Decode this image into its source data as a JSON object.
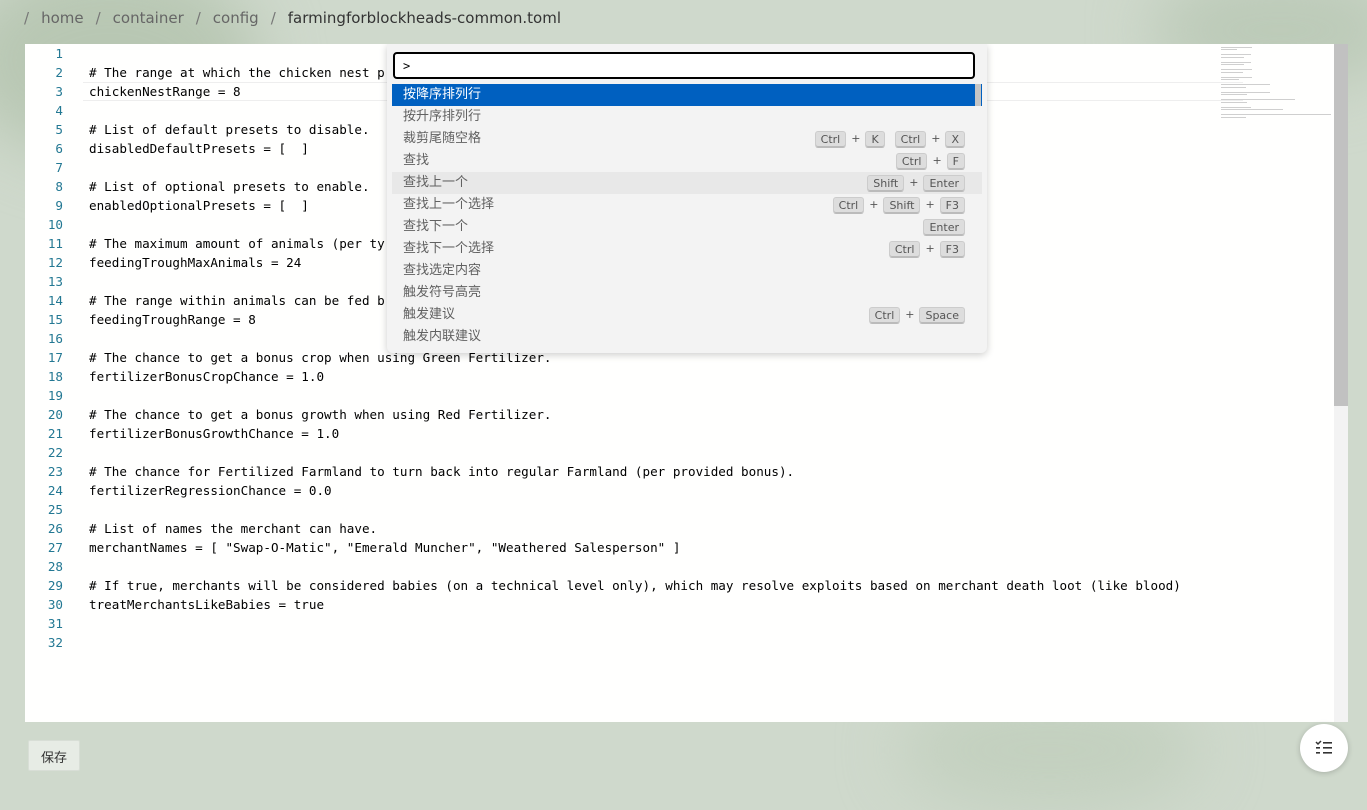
{
  "breadcrumb": [
    {
      "label": "home"
    },
    {
      "label": "container"
    },
    {
      "label": "config"
    },
    {
      "label": "farmingforblockheads-common.toml"
    }
  ],
  "breadcrumb_separator": "/",
  "editor": {
    "lines": [
      {
        "n": "1",
        "text": ""
      },
      {
        "n": "2",
        "text": "# The range at which the chicken nest p"
      },
      {
        "n": "3",
        "text": "chickenNestRange = 8"
      },
      {
        "n": "4",
        "text": ""
      },
      {
        "n": "5",
        "text": "# List of default presets to disable."
      },
      {
        "n": "6",
        "text": "disabledDefaultPresets = [  ]"
      },
      {
        "n": "7",
        "text": ""
      },
      {
        "n": "8",
        "text": "# List of optional presets to enable."
      },
      {
        "n": "9",
        "text": "enabledOptionalPresets = [  ]"
      },
      {
        "n": "10",
        "text": ""
      },
      {
        "n": "11",
        "text": "# The maximum amount of animals (per ty"
      },
      {
        "n": "12",
        "text": "feedingTroughMaxAnimals = 24"
      },
      {
        "n": "13",
        "text": ""
      },
      {
        "n": "14",
        "text": "# The range within animals can be fed b"
      },
      {
        "n": "15",
        "text": "feedingTroughRange = 8"
      },
      {
        "n": "16",
        "text": ""
      },
      {
        "n": "17",
        "text": "# The chance to get a bonus crop when using Green Fertilizer."
      },
      {
        "n": "18",
        "text": "fertilizerBonusCropChance = 1.0"
      },
      {
        "n": "19",
        "text": ""
      },
      {
        "n": "20",
        "text": "# The chance to get a bonus growth when using Red Fertilizer."
      },
      {
        "n": "21",
        "text": "fertilizerBonusGrowthChance = 1.0"
      },
      {
        "n": "22",
        "text": ""
      },
      {
        "n": "23",
        "text": "# The chance for Fertilized Farmland to turn back into regular Farmland (per provided bonus)."
      },
      {
        "n": "24",
        "text": "fertilizerRegressionChance = 0.0"
      },
      {
        "n": "25",
        "text": ""
      },
      {
        "n": "26",
        "text": "# List of names the merchant can have."
      },
      {
        "n": "27",
        "text": "merchantNames = [ \"Swap-O-Matic\", \"Emerald Muncher\", \"Weathered Salesperson\" ]"
      },
      {
        "n": "28",
        "text": ""
      },
      {
        "n": "29",
        "text": "# If true, merchants will be considered babies (on a technical level only), which may resolve exploits based on merchant death loot (like blood)"
      },
      {
        "n": "30",
        "text": "treatMerchantsLikeBabies = true"
      },
      {
        "n": "31",
        "text": ""
      },
      {
        "n": "32",
        "text": ""
      }
    ]
  },
  "command_palette": {
    "input_value": ">",
    "items": [
      {
        "label": "按降序排列行",
        "state": "selected",
        "keys": []
      },
      {
        "label": "按升序排列行",
        "state": "",
        "keys": []
      },
      {
        "label": "裁剪尾随空格",
        "state": "",
        "keys": [
          [
            "Ctrl",
            "K"
          ],
          [
            "Ctrl",
            "X"
          ]
        ]
      },
      {
        "label": "查找",
        "state": "",
        "keys": [
          [
            "Ctrl",
            "F"
          ]
        ]
      },
      {
        "label": "查找上一个",
        "state": "hover",
        "keys": [
          [
            "Shift",
            "Enter"
          ]
        ]
      },
      {
        "label": "查找上一个选择",
        "state": "",
        "keys": [
          [
            "Ctrl",
            "Shift",
            "F3"
          ]
        ]
      },
      {
        "label": "查找下一个",
        "state": "",
        "keys": [
          [
            "Enter"
          ]
        ]
      },
      {
        "label": "查找下一个选择",
        "state": "",
        "keys": [
          [
            "Ctrl",
            "F3"
          ]
        ]
      },
      {
        "label": "查找选定内容",
        "state": "",
        "keys": []
      },
      {
        "label": "触发符号高亮",
        "state": "",
        "keys": []
      },
      {
        "label": "触发建议",
        "state": "",
        "keys": [
          [
            "Ctrl",
            "Space"
          ]
        ]
      },
      {
        "label": "触发内联建议",
        "state": "",
        "keys": []
      }
    ]
  },
  "footer": {
    "save_label": "保存",
    "fab_icon": "list-outline-icon"
  },
  "colors": {
    "accent": "#0060c0",
    "line_number": "#237893"
  }
}
